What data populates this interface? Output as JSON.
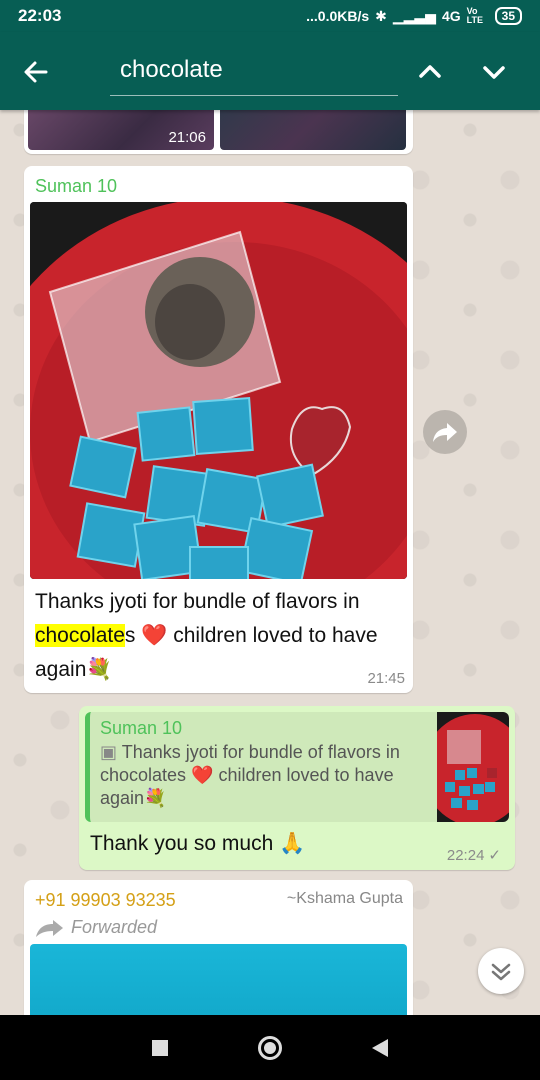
{
  "status_bar": {
    "time": "22:03",
    "network_speed": "...0.0KB/s",
    "network_type": "4G",
    "volte": "Vo LTE",
    "battery": "35"
  },
  "app_bar": {
    "search_value": "chocolate"
  },
  "messages": [
    {
      "type": "image",
      "time": "21:06"
    },
    {
      "type": "image_caption",
      "sender": "Suman 10",
      "caption_before": "Thanks jyoti for bundle of flavors in ",
      "caption_highlight": "chocolate",
      "caption_after": "s ❤️ children loved to have again💐",
      "time": "21:45"
    },
    {
      "type": "reply_outgoing",
      "quoted_sender": "Suman 10",
      "quoted_text": "Thanks jyoti for bundle of flavors in chocolates ❤️ children loved to have again💐",
      "text": "Thank you so much 🙏",
      "time": "22:24",
      "status": "✓"
    },
    {
      "type": "forwarded",
      "sender_phone": "+91 99903 93235",
      "push_name": "~Kshama Gupta",
      "forwarded_label": "Forwarded"
    }
  ],
  "colors": {
    "header": "#075e54",
    "sender_green": "#4fc25a",
    "outgoing_bubble": "#dcf8c6",
    "highlight": "#ffff00",
    "phone_sender": "#d4a017"
  }
}
